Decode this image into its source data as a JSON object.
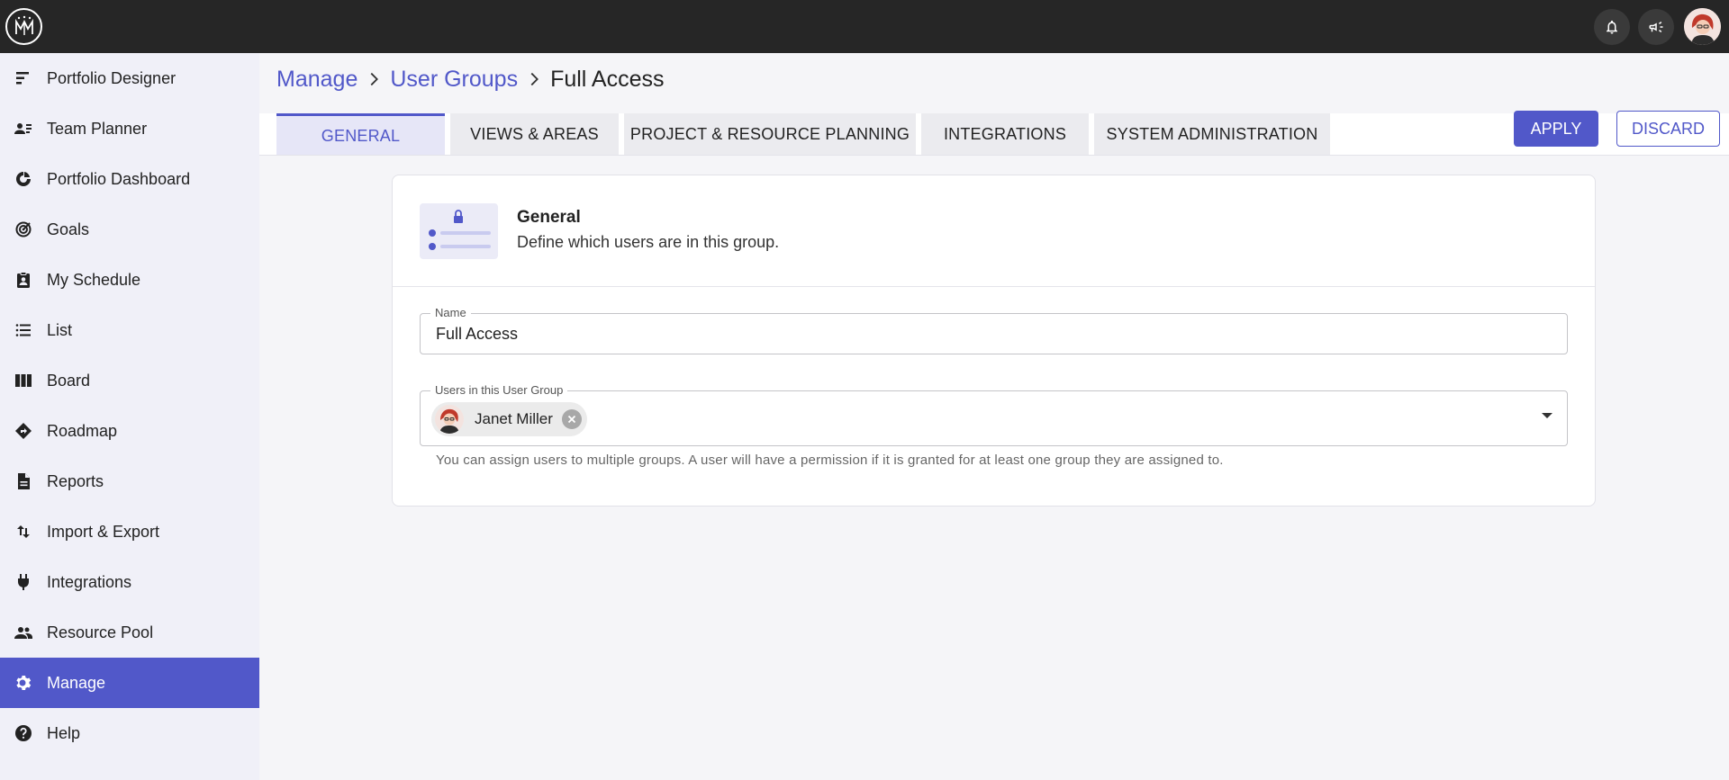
{
  "topbar": {
    "logo_icon": "mm-crown-logo-icon",
    "notifications_icon": "bell-icon",
    "announcements_icon": "megaphone-icon",
    "avatar_icon": "user-avatar-icon"
  },
  "sidebar": {
    "items": [
      {
        "label": "Portfolio Designer",
        "icon": "portfolio-designer-icon"
      },
      {
        "label": "Team Planner",
        "icon": "team-planner-icon"
      },
      {
        "label": "Portfolio Dashboard",
        "icon": "dashboard-icon"
      },
      {
        "label": "Goals",
        "icon": "target-icon"
      },
      {
        "label": "My Schedule",
        "icon": "schedule-icon"
      },
      {
        "label": "List",
        "icon": "list-icon"
      },
      {
        "label": "Board",
        "icon": "board-icon"
      },
      {
        "label": "Roadmap",
        "icon": "roadmap-icon"
      },
      {
        "label": "Reports",
        "icon": "report-icon"
      },
      {
        "label": "Import & Export",
        "icon": "import-export-icon"
      },
      {
        "label": "Integrations",
        "icon": "plug-icon"
      },
      {
        "label": "Resource Pool",
        "icon": "people-icon"
      },
      {
        "label": "Manage",
        "icon": "gear-icon",
        "active": true
      },
      {
        "label": "Help",
        "icon": "help-icon"
      }
    ]
  },
  "breadcrumb": {
    "items": [
      "Manage",
      "User Groups"
    ],
    "current": "Full Access"
  },
  "tabs": [
    {
      "label": "GENERAL",
      "active": true
    },
    {
      "label": "VIEWS & AREAS"
    },
    {
      "label": "PROJECT & RESOURCE PLANNING"
    },
    {
      "label": "INTEGRATIONS"
    },
    {
      "label": "SYSTEM ADMINISTRATION"
    }
  ],
  "actions": {
    "apply": "APPLY",
    "discard": "DISCARD"
  },
  "card": {
    "title": "General",
    "subtitle": "Define which users are in this group.",
    "illustration_icon": "lock-list-illustration-icon",
    "name_field": {
      "label": "Name",
      "value": "Full Access"
    },
    "users_field": {
      "label": "Users in this User Group",
      "chips": [
        {
          "label": "Janet Miller"
        }
      ],
      "helper": "You can assign users to multiple groups. A user will have a permission if it is granted for at least one group they are assigned to."
    }
  },
  "colors": {
    "accent": "#5158c9",
    "topbar": "#262626",
    "sidebar": "#f0f0f8"
  }
}
